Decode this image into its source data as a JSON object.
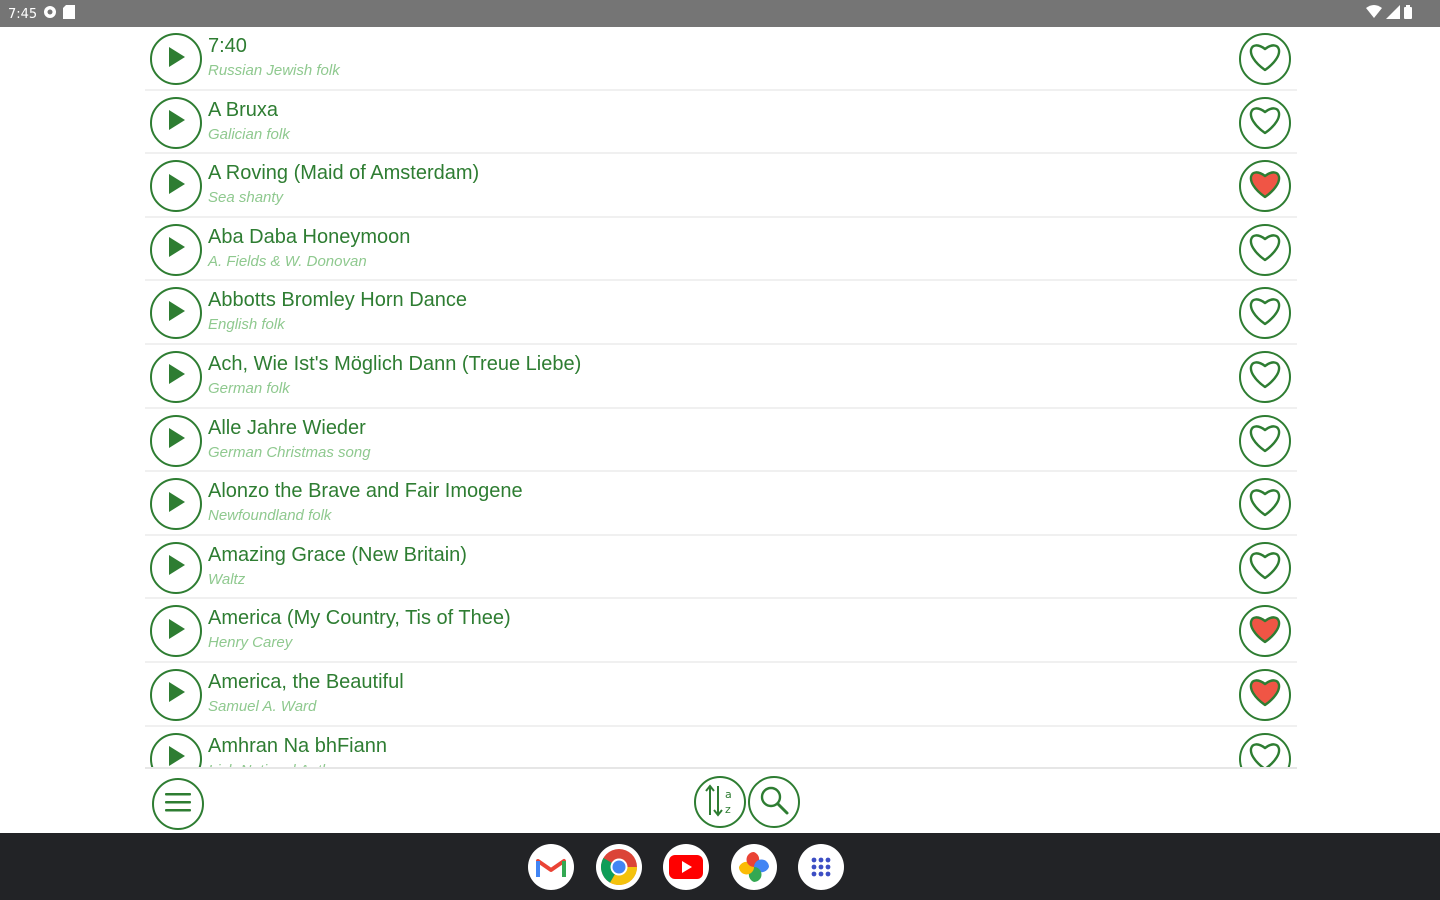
{
  "status_bar": {
    "time": "7:45",
    "icons": [
      "settings-icon",
      "sd-card-icon",
      "wifi-icon",
      "signal-icon",
      "battery-icon"
    ]
  },
  "songs": [
    {
      "title": "7:40",
      "subtitle": "Russian Jewish folk",
      "favorite": false
    },
    {
      "title": "A Bruxa",
      "subtitle": "Galician folk",
      "favorite": false
    },
    {
      "title": "A Roving (Maid of Amsterdam)",
      "subtitle": "Sea shanty",
      "favorite": true
    },
    {
      "title": "Aba Daba Honeymoon",
      "subtitle": "A. Fields & W. Donovan",
      "favorite": false
    },
    {
      "title": "Abbotts Bromley Horn Dance",
      "subtitle": "English folk",
      "favorite": false
    },
    {
      "title": "Ach, Wie Ist's Möglich Dann (Treue Liebe)",
      "subtitle": "German folk",
      "favorite": false
    },
    {
      "title": "Alle Jahre Wieder",
      "subtitle": "German Christmas song",
      "favorite": false
    },
    {
      "title": "Alonzo the Brave and Fair Imogene",
      "subtitle": "Newfoundland folk",
      "favorite": false
    },
    {
      "title": "Amazing Grace (New Britain)",
      "subtitle": "Waltz",
      "favorite": false
    },
    {
      "title": "America (My Country, Tis of Thee)",
      "subtitle": "Henry Carey",
      "favorite": true
    },
    {
      "title": "America, the Beautiful",
      "subtitle": "Samuel A. Ward",
      "favorite": true
    },
    {
      "title": "Amhran Na bhFiann",
      "subtitle": "Irish National Anthem",
      "favorite": false
    }
  ],
  "toolbar": {
    "menu_icon": "hamburger-menu-icon",
    "sort_icon": "sort-az-icon",
    "search_icon": "search-icon"
  },
  "dock": {
    "apps": [
      "gmail-icon",
      "chrome-icon",
      "youtube-icon",
      "photos-icon",
      "app-drawer-icon"
    ]
  },
  "colors": {
    "accent": "#2e7d32",
    "subtitle": "#8fc98f",
    "favorite": "#f05545",
    "status_bar": "#757575",
    "nav_bar": "#222326"
  }
}
